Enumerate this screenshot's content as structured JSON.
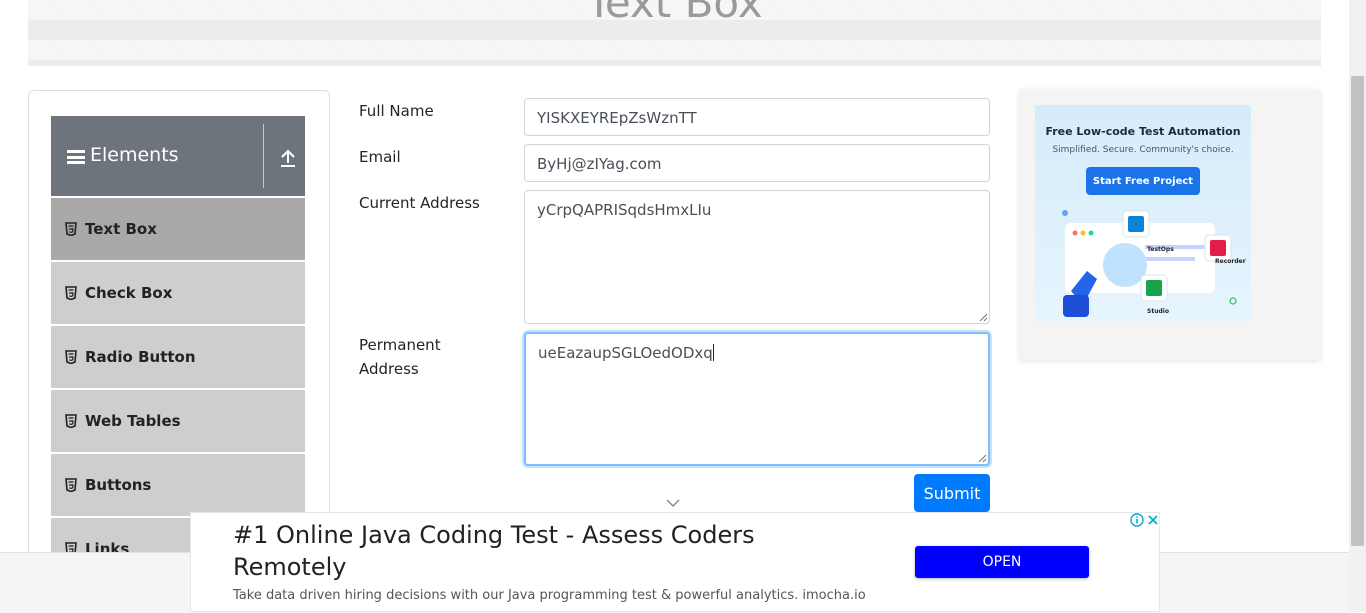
{
  "page": {
    "title": "Text Box"
  },
  "sidebar": {
    "header_label": "Elements",
    "items": [
      {
        "label": "Text Box",
        "active": true
      },
      {
        "label": "Check Box",
        "active": false
      },
      {
        "label": "Radio Button",
        "active": false
      },
      {
        "label": "Web Tables",
        "active": false
      },
      {
        "label": "Buttons",
        "active": false
      },
      {
        "label": "Links",
        "active": false
      }
    ]
  },
  "form": {
    "full_name": {
      "label": "Full Name",
      "value": "YISKXEYREpZsWznTT"
    },
    "email": {
      "label": "Email",
      "value": "ByHj@zIYag.com"
    },
    "current_address": {
      "label": "Current Address",
      "value": "yCrpQAPRISqdsHmxLIu"
    },
    "permanent_address": {
      "label_line1": "Permanent",
      "label_line2": "Address",
      "value": "ueEazaupSGLOedODxq"
    },
    "submit_label": "Submit"
  },
  "side_ad": {
    "headline": "Free Low-code Test Automation",
    "subline": "Simplified. Secure. Community's choice.",
    "cta": "Start Free Project",
    "tags": [
      "TestOps",
      "Recorder",
      "Studio"
    ]
  },
  "bottom_ad": {
    "title": "#1 Online Java Coding Test - Assess Coders Remotely",
    "description": "Take data driven hiring decisions with our Java programming test & powerful analytics. imocha.io",
    "open_label": "OPEN"
  },
  "colors": {
    "primary": "#007bff",
    "sidebar_header": "#6e747c",
    "menu_item": "#cecece",
    "menu_item_active": "#a9a9a9",
    "open_button": "#0000ff"
  },
  "icons": [
    "hamburger-icon",
    "arrow-up-icon",
    "html5-icon",
    "chevron-down-icon",
    "adchoices-icon",
    "close-icon"
  ]
}
